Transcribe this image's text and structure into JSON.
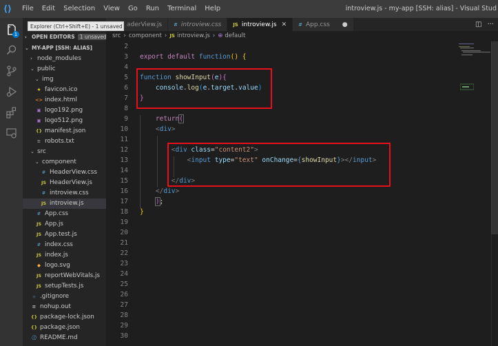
{
  "titlebar": {
    "menu": [
      "File",
      "Edit",
      "Selection",
      "View",
      "Go",
      "Run",
      "Terminal",
      "Help"
    ],
    "window_title": "introview.js - my-app [SSH: alias] - Visual Stud"
  },
  "tooltip": "Explorer (Ctrl+Shift+E) - 1 unsaved file",
  "activity": {
    "badge": "1"
  },
  "sidebar": {
    "open_editors_label": "OPEN EDITORS",
    "open_editors_badge": "1 unsaved",
    "root_label": "MY-APP [SSH: ALIAS]",
    "items": [
      {
        "label": "node_modules",
        "icon": "chevron-right",
        "depth": 1
      },
      {
        "label": "public",
        "icon": "chevron-down",
        "depth": 1
      },
      {
        "label": "img",
        "icon": "chevron-down",
        "depth": 2
      },
      {
        "label": "favicon.ico",
        "icon": "favicon",
        "depth": 2
      },
      {
        "label": "index.html",
        "icon": "html",
        "depth": 2
      },
      {
        "label": "logo192.png",
        "icon": "image",
        "depth": 2
      },
      {
        "label": "logo512.png",
        "icon": "image",
        "depth": 2
      },
      {
        "label": "manifest.json",
        "icon": "json",
        "depth": 2
      },
      {
        "label": "robots.txt",
        "icon": "text",
        "depth": 2
      },
      {
        "label": "src",
        "icon": "chevron-down",
        "depth": 1
      },
      {
        "label": "component",
        "icon": "chevron-down",
        "depth": 2
      },
      {
        "label": "HeaderView.css",
        "icon": "css",
        "depth": 3
      },
      {
        "label": "HeaderView.js",
        "icon": "js",
        "depth": 3
      },
      {
        "label": "introview.css",
        "icon": "css",
        "depth": 3
      },
      {
        "label": "introview.js",
        "icon": "js",
        "depth": 3,
        "active": true
      },
      {
        "label": "App.css",
        "icon": "css",
        "depth": 2
      },
      {
        "label": "App.js",
        "icon": "js",
        "depth": 2
      },
      {
        "label": "App.test.js",
        "icon": "js",
        "depth": 2
      },
      {
        "label": "index.css",
        "icon": "css",
        "depth": 2
      },
      {
        "label": "index.js",
        "icon": "js",
        "depth": 2
      },
      {
        "label": "logo.svg",
        "icon": "svg",
        "depth": 2
      },
      {
        "label": "reportWebVitals.js",
        "icon": "js",
        "depth": 2
      },
      {
        "label": "setupTests.js",
        "icon": "js",
        "depth": 2
      },
      {
        "label": ".gitignore",
        "icon": "git",
        "depth": 1
      },
      {
        "label": "nohup.out",
        "icon": "lines",
        "depth": 1
      },
      {
        "label": "package-lock.json",
        "icon": "json",
        "depth": 1
      },
      {
        "label": "package.json",
        "icon": "json",
        "depth": 1
      },
      {
        "label": "README.md",
        "icon": "info",
        "depth": 1
      }
    ]
  },
  "tabs": [
    {
      "label": "aderView.js",
      "icon": "",
      "active": false,
      "italic": false
    },
    {
      "label": "introview.css",
      "icon": "#",
      "active": false,
      "italic": true
    },
    {
      "label": "introview.js",
      "icon": "JS",
      "active": true,
      "italic": false
    },
    {
      "label": "App.css",
      "icon": "#",
      "active": false,
      "italic": false,
      "dirty": true
    }
  ],
  "breadcrumb": {
    "parts": [
      "src",
      "component",
      "introview.js",
      "default"
    ]
  },
  "editor": {
    "line_numbers": [
      "2",
      "3",
      "4",
      "5",
      "6",
      "7",
      "8",
      "9",
      "10",
      "11",
      "12",
      "13",
      "14",
      "15",
      "16",
      "17",
      "18",
      "19",
      "20",
      "21",
      "22",
      "23",
      "24",
      "25",
      "26",
      "27",
      "28",
      "29",
      "30"
    ]
  },
  "colors": {
    "highlight_box": "#e8101a",
    "accent": "#007acc"
  }
}
